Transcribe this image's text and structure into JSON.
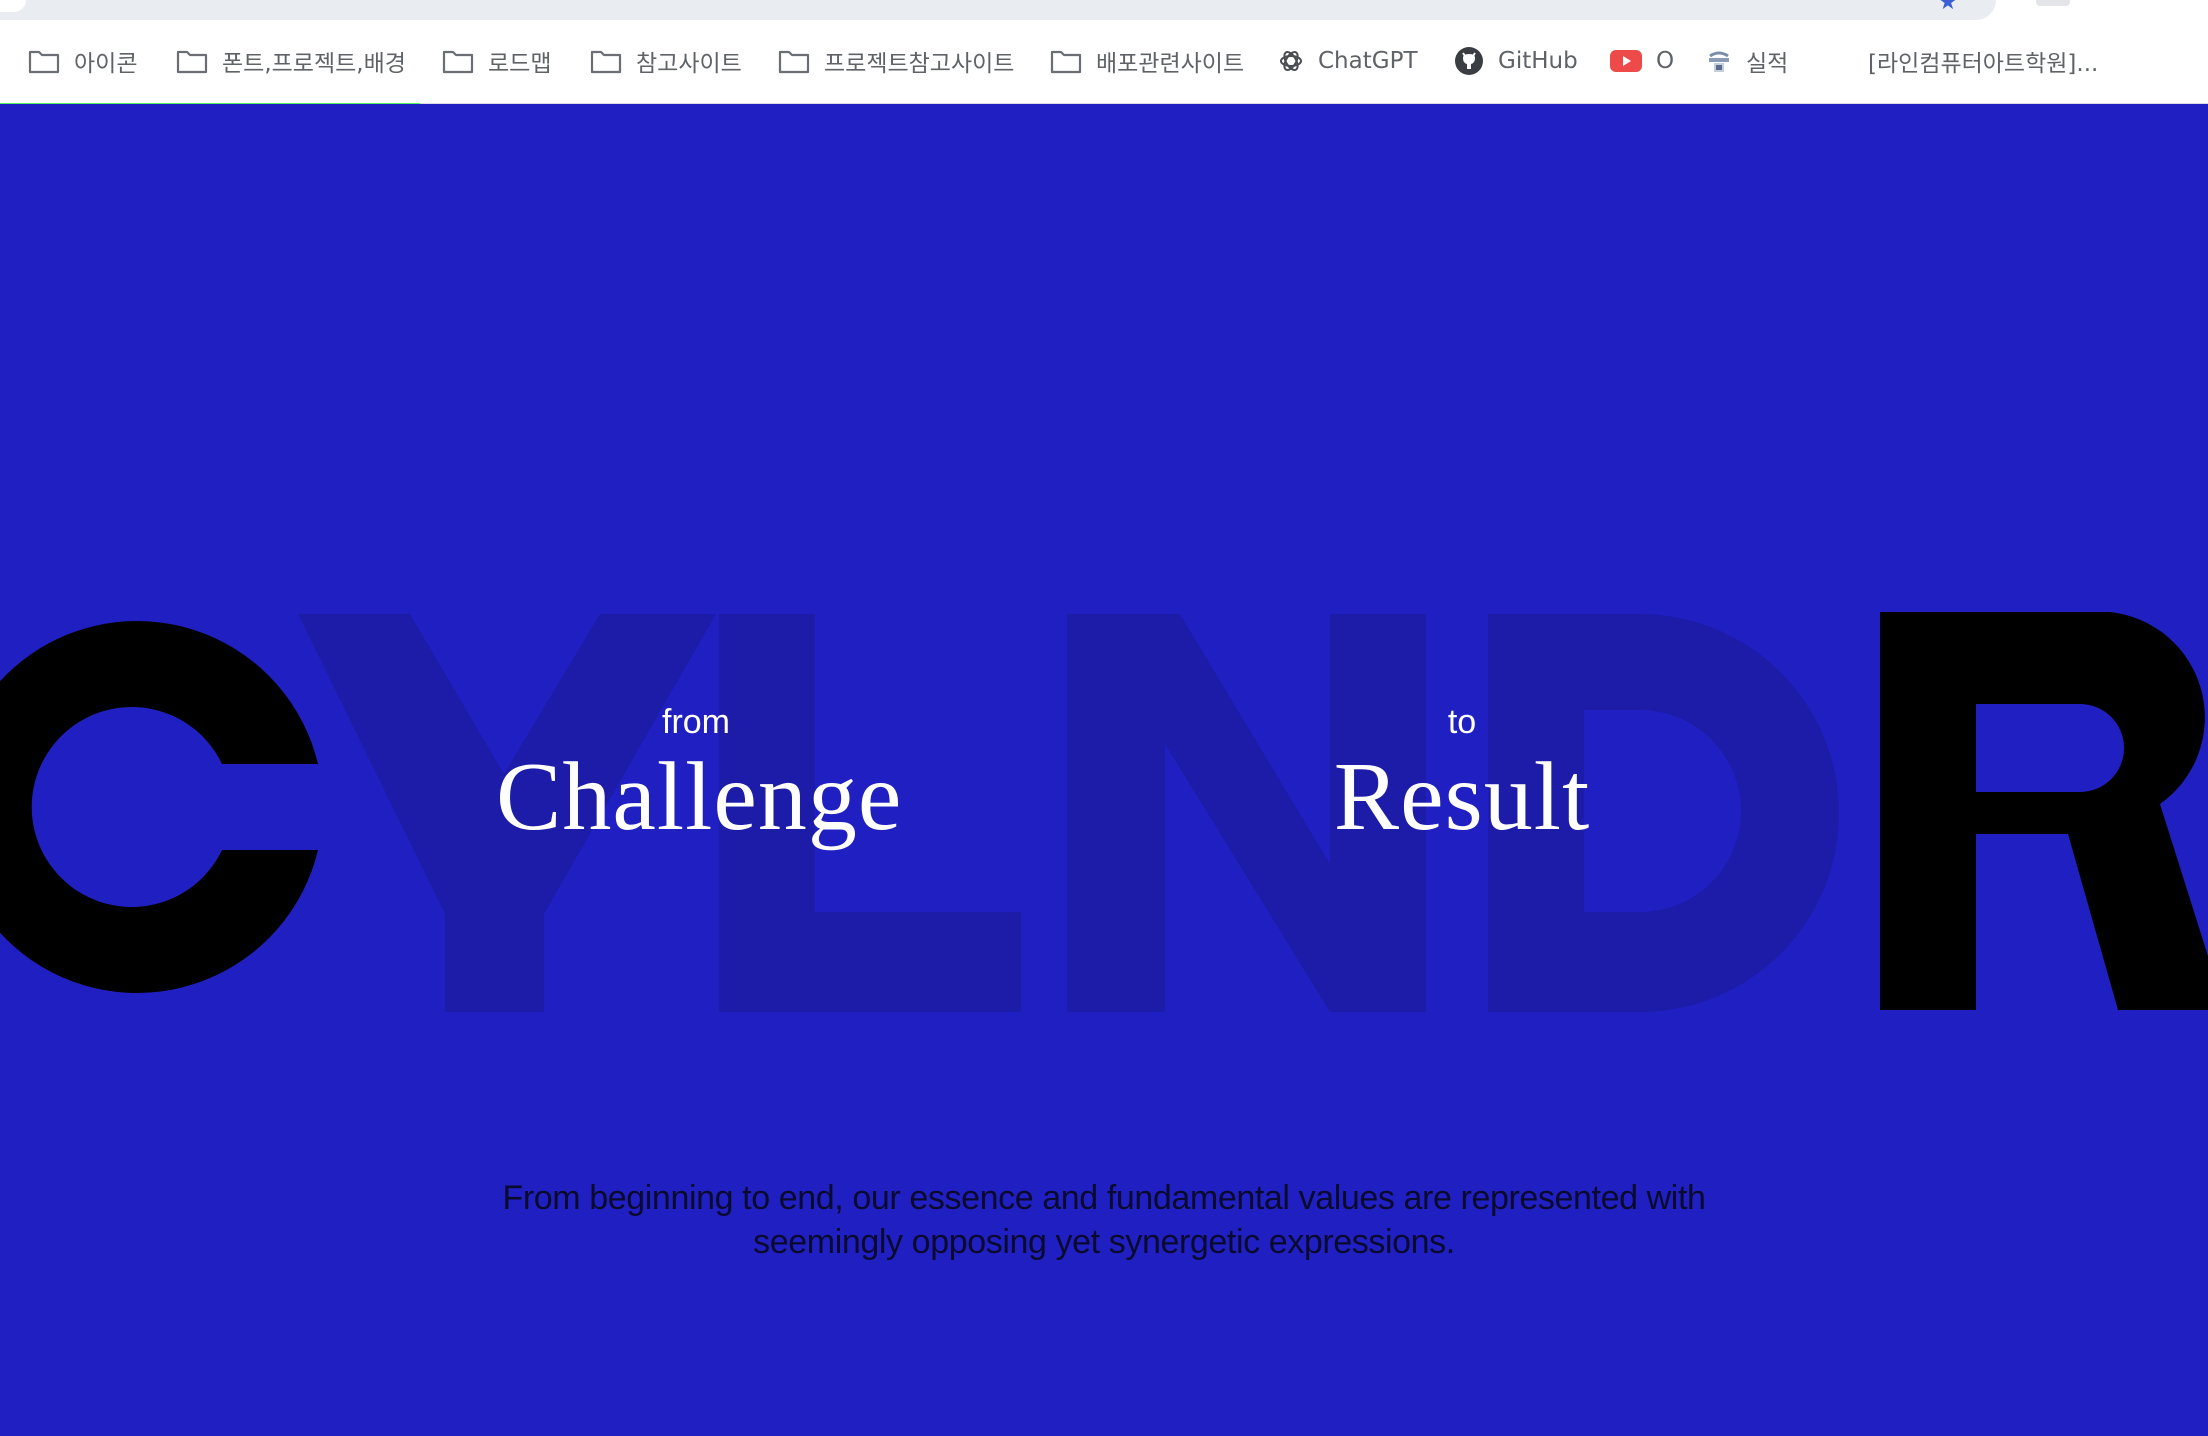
{
  "bookmarks": [
    {
      "label": "아이콘",
      "icon": "folder-icon"
    },
    {
      "label": "폰트,프로젝트,배경",
      "icon": "folder-icon"
    },
    {
      "label": "로드맵",
      "icon": "folder-icon"
    },
    {
      "label": "참고사이트",
      "icon": "folder-icon"
    },
    {
      "label": "프로젝트참고사이트",
      "icon": "folder-icon"
    },
    {
      "label": "배포관련사이트",
      "icon": "folder-icon"
    },
    {
      "label": "ChatGPT",
      "icon": "chatgpt-icon"
    },
    {
      "label": "GitHub",
      "icon": "github-icon"
    },
    {
      "label": "O",
      "icon": "youtube-icon"
    },
    {
      "label": "실적",
      "icon": "site-icon"
    },
    {
      "label": "[라인컴퓨터아트학원]...",
      "icon": "none"
    }
  ],
  "loading_progress": 0.19,
  "hero": {
    "background_word": "CYLNDR",
    "left_caption": {
      "small": "from",
      "big": "Challenge"
    },
    "right_caption": {
      "small": "to",
      "big": "Result"
    },
    "tagline_line1": "From beginning to end, our essence and fundamental values are represented with",
    "tagline_line2": "seemingly opposing yet synergetic expressions."
  },
  "colors": {
    "background": "#2020c2",
    "faded_letters": "#1c1ca8",
    "solid_letters": "#000000",
    "progress": "#55f25a",
    "text": "#ffffff"
  }
}
